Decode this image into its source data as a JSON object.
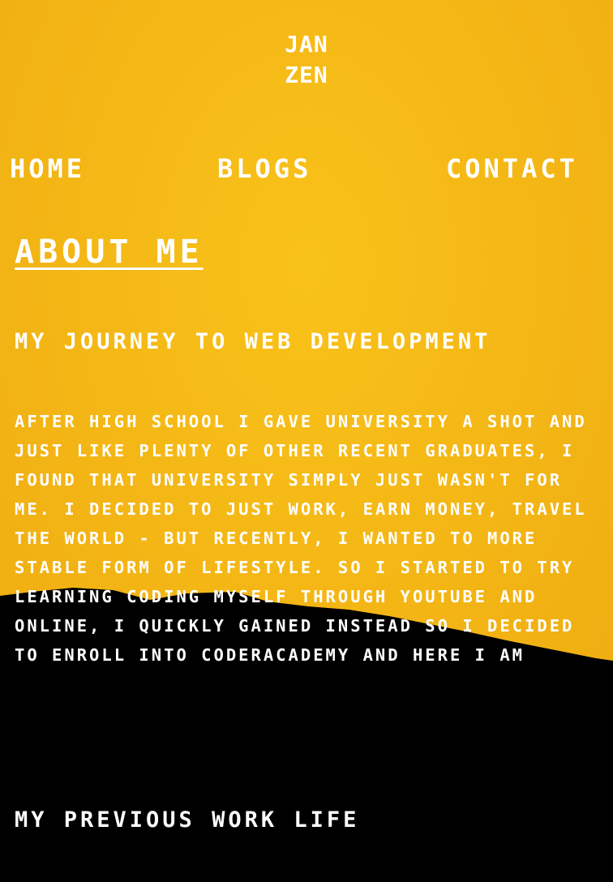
{
  "logo": {
    "line1": "JAN",
    "line2": "ZEN"
  },
  "nav": {
    "home": "HOME",
    "blogs": "BLOGS",
    "contact": "CONTACT"
  },
  "about": {
    "title": "ABOUT ME",
    "journey_heading": "MY JOURNEY TO WEB DEVELOPMENT",
    "journey_text": "AFTER HIGH SCHOOL I GAVE UNIVERSITY A SHOT AND JUST LIKE PLENTY OF OTHER RECENT GRADUATES, I FOUND THAT UNIVERSITY SIMPLY JUST WASN'T FOR ME. I DECIDED TO JUST WORK, EARN MONEY, TRAVEL THE WORLD - BUT RECENTLY, I WANTED TO MORE STABLE FORM OF LIFESTYLE. SO I STARTED TO TRY LEARNING CODING MYSELF THROUGH YOUTUBE AND ONLINE, I QUICKLY GAINED INSTEAD SO I DECIDED TO ENROLL INTO CODERACADEMY AND HERE I AM",
    "work_heading": "MY PREVIOUS WORK LIFE"
  },
  "colors": {
    "background_yellow": "#f5b512",
    "background_black": "#000000",
    "text": "#ffffff"
  }
}
